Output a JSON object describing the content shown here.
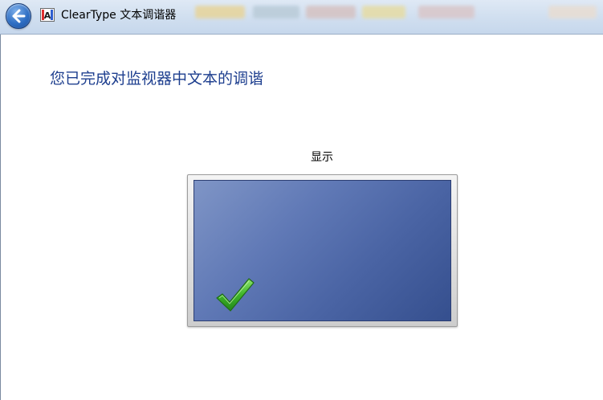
{
  "window": {
    "title": "ClearType 文本调谐器"
  },
  "icons": {
    "back": "back-arrow-icon",
    "app": "cleartype-app-icon",
    "check": "checkmark-icon"
  },
  "main": {
    "heading": "您已完成对监视器中文本的调谐",
    "display_label": "显示"
  },
  "colors": {
    "heading": "#1e3f8f",
    "screen": "#4a64a4",
    "check": "#3fb52a"
  }
}
